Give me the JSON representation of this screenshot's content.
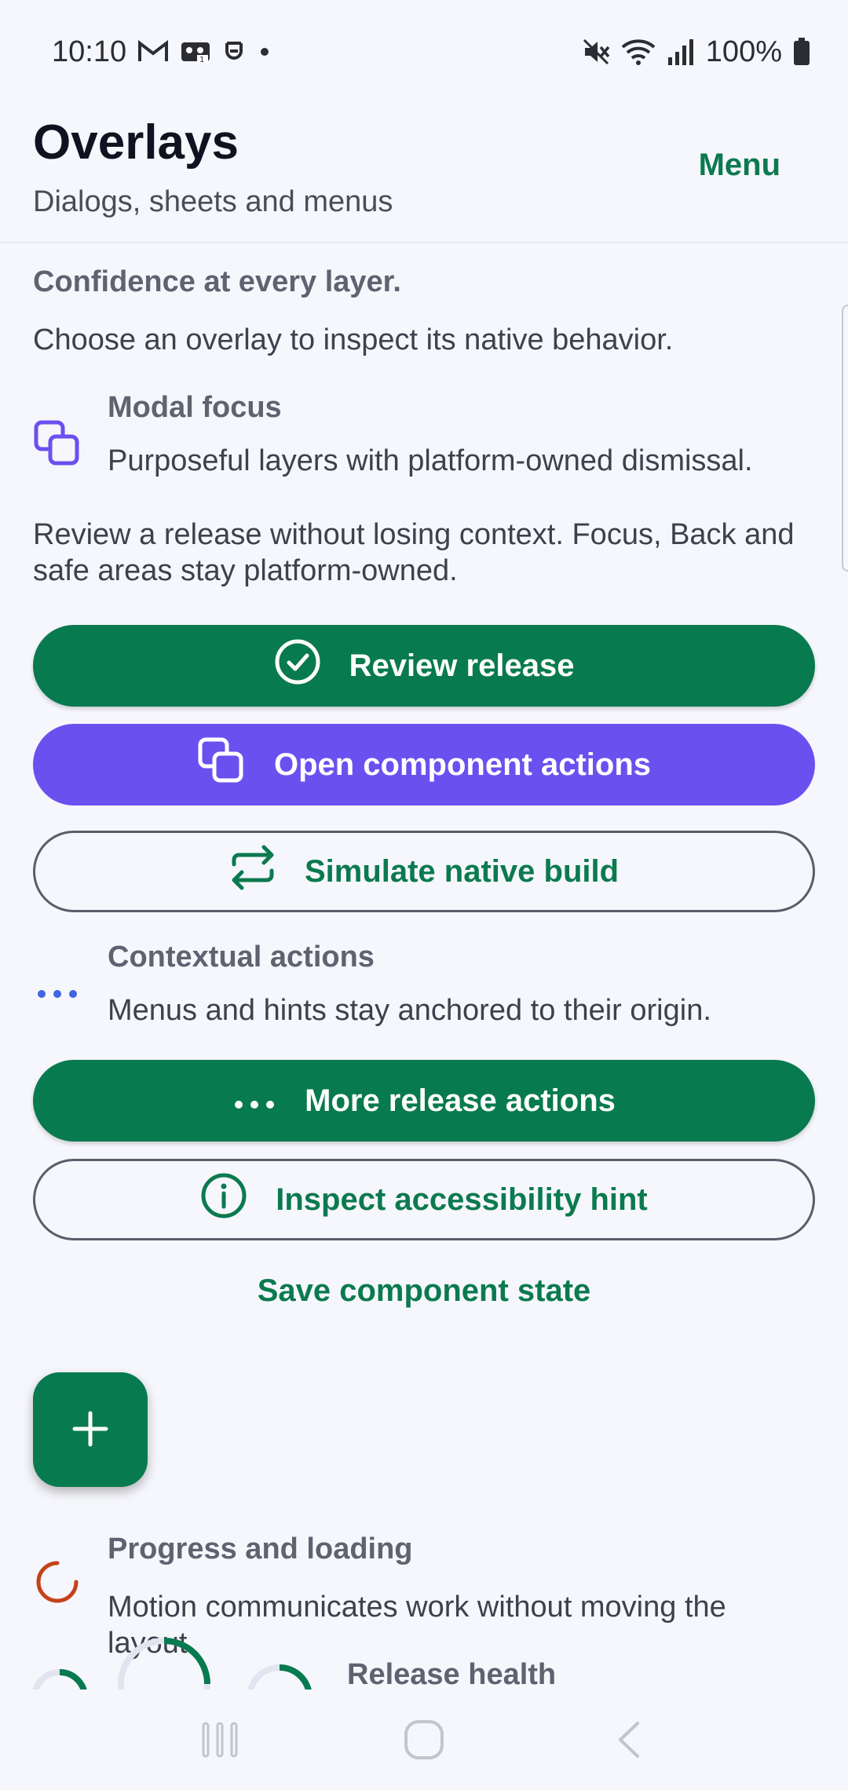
{
  "status_bar": {
    "time": "10:10",
    "battery": "100%",
    "left_icons": [
      "gmail-icon",
      "voicemail-icon",
      "alert-icon",
      "dot-icon"
    ],
    "right_icons": [
      "mute-icon",
      "wifi-icon",
      "signal-icon",
      "battery-icon"
    ]
  },
  "header": {
    "title": "Overlays",
    "subtitle": "Dialogs, sheets and menus",
    "menu_label": "Menu"
  },
  "content": {
    "tagline": "Confidence at every layer.",
    "intro": "Choose an overlay to inspect its native behavior.",
    "modal_focus": {
      "title": "Modal focus",
      "description": "Purposeful layers with platform-owned dismissal.",
      "icon": "copy-icon"
    },
    "review_paragraph": "Review a release without losing context. Focus, Back and safe areas stay platform-owned.",
    "buttons": {
      "review_release": "Review release",
      "open_component_actions": "Open component actions",
      "simulate_native_build": "Simulate native build",
      "more_release_actions": "More release actions",
      "inspect_accessibility_hint": "Inspect accessibility hint",
      "save_component_state": "Save component state"
    },
    "contextual_actions": {
      "title": "Contextual actions",
      "description": "Menus and hints stay anchored to their origin.",
      "icon": "more-horizontal-icon"
    },
    "progress_loading": {
      "title": "Progress and loading",
      "description": "Motion communicates work without moving the layout.",
      "icon": "spinner-icon"
    },
    "release_health_label": "Release health"
  },
  "colors": {
    "primary": "#087a4f",
    "accent": "#6b50f0",
    "background": "#f6f7fc",
    "spinner": "#c4431a"
  }
}
